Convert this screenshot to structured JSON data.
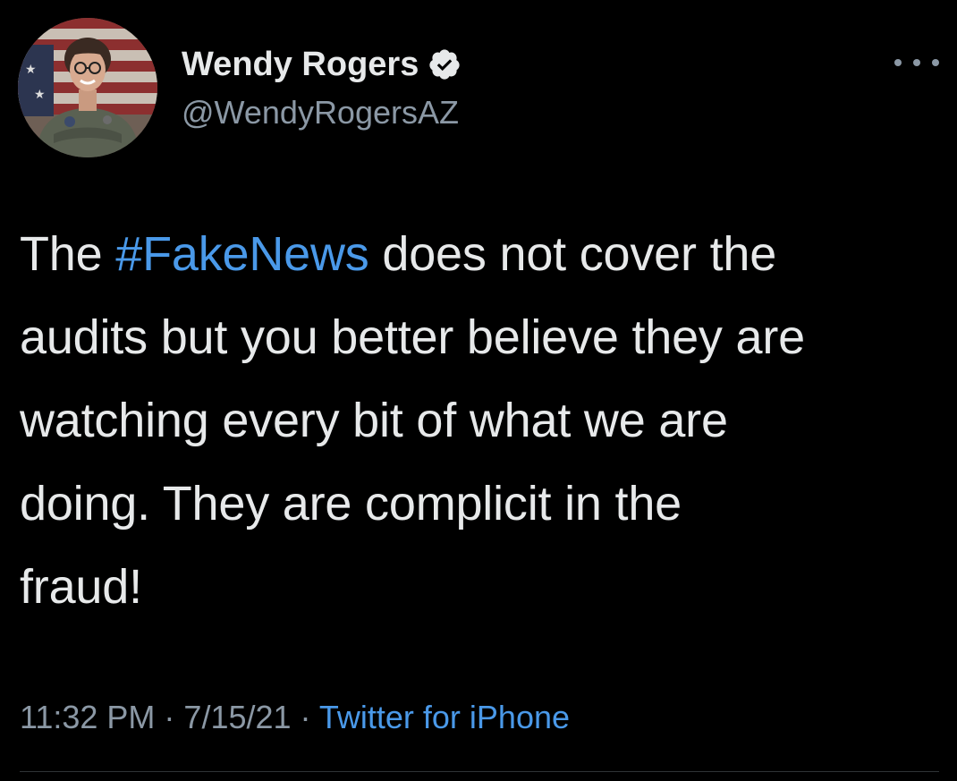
{
  "author": {
    "name": "Wendy Rogers",
    "handle": "@WendyRogersAZ",
    "verified": true,
    "avatar_icon": "profile-photo"
  },
  "menu": {
    "icon": "more-horizontal-icon"
  },
  "tweet": {
    "lines": [
      {
        "pre": "The ",
        "hashtag": "#FakeNews",
        "post": " does not cover the"
      },
      {
        "text": "audits but you better believe they are"
      },
      {
        "text": "watching every bit of what we are"
      },
      {
        "text": "doing. They are complicit in the"
      },
      {
        "text": "fraud!"
      }
    ]
  },
  "meta": {
    "time": "11:32 PM",
    "sep1": " · ",
    "date": "7/15/21",
    "sep2": " · ",
    "source": "Twitter for iPhone"
  },
  "colors": {
    "background": "#000000",
    "text": "#e7e9ea",
    "secondary": "#8b98a5",
    "link": "#4a99e9",
    "divider": "#2f3336"
  }
}
